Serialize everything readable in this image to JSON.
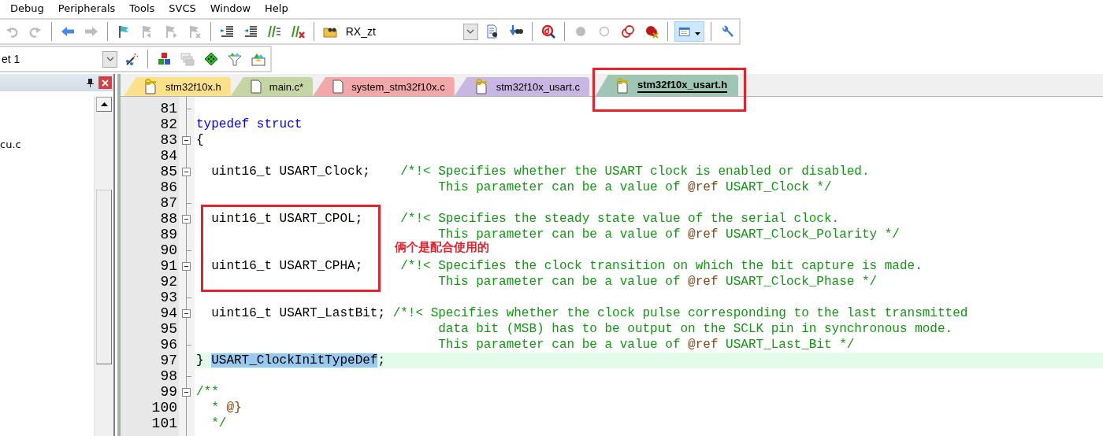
{
  "menu": [
    "Debug",
    "Peripherals",
    "Tools",
    "SVCS",
    "Window",
    "Help"
  ],
  "toolbar_1": {
    "items": [
      {
        "kind": "undo",
        "disabled": true,
        "pressed": false
      },
      {
        "kind": "redo",
        "disabled": true,
        "pressed": false
      },
      {
        "kind": "separator"
      },
      {
        "kind": "back",
        "disabled": false,
        "pressed": false
      },
      {
        "kind": "forward",
        "disabled": true,
        "pressed": false
      },
      {
        "kind": "separator"
      },
      {
        "kind": "flag",
        "disabled": false,
        "pressed": false
      },
      {
        "kind": "flagprev",
        "disabled": true,
        "pressed": false
      },
      {
        "kind": "flagnext",
        "disabled": true,
        "pressed": false
      },
      {
        "kind": "flagclear",
        "disabled": true,
        "pressed": false
      },
      {
        "kind": "separator"
      },
      {
        "kind": "indent",
        "disabled": false,
        "pressed": false
      },
      {
        "kind": "unindent",
        "disabled": false,
        "pressed": false
      },
      {
        "kind": "comment",
        "disabled": false,
        "pressed": false
      },
      {
        "kind": "uncomment",
        "disabled": false,
        "pressed": false
      },
      {
        "kind": "separator"
      },
      {
        "kind": "findfiles",
        "disabled": false,
        "pressed": false
      },
      {
        "kind": "combo",
        "value": "RX_zt"
      },
      {
        "kind": "docfind",
        "disabled": false,
        "pressed": false
      },
      {
        "kind": "binoculars",
        "disabled": false,
        "pressed": false
      },
      {
        "kind": "separator"
      },
      {
        "kind": "debug",
        "disabled": false,
        "pressed": false
      },
      {
        "kind": "separator"
      },
      {
        "kind": "dot",
        "disabled": true,
        "pressed": false
      },
      {
        "kind": "ring",
        "disabled": true,
        "pressed": false
      },
      {
        "kind": "rings",
        "disabled": false,
        "pressed": false
      },
      {
        "kind": "dotx",
        "disabled": false,
        "pressed": false
      },
      {
        "kind": "separator"
      },
      {
        "kind": "window",
        "disabled": false,
        "pressed": true
      },
      {
        "kind": "separator"
      },
      {
        "kind": "wrench",
        "disabled": false,
        "pressed": false
      }
    ]
  },
  "toolbar_2": {
    "items": [
      {
        "kind": "combo",
        "value": "et 1"
      },
      {
        "kind": "wand",
        "disabled": false,
        "pressed": false
      },
      {
        "kind": "separator"
      },
      {
        "kind": "blocks",
        "disabled": false,
        "pressed": false
      },
      {
        "kind": "stack",
        "disabled": true,
        "pressed": false
      },
      {
        "kind": "diamond",
        "disabled": false,
        "pressed": false
      },
      {
        "kind": "funnel",
        "disabled": false,
        "pressed": false
      },
      {
        "kind": "pack",
        "disabled": false,
        "pressed": false
      }
    ]
  },
  "project_panel": {
    "items": [
      "cu.c"
    ]
  },
  "editor": {
    "tabs": [
      {
        "label": "stm32f10x.h",
        "kind": "header",
        "color": "#fde18a",
        "selected": false
      },
      {
        "label": "main.c*",
        "kind": "source",
        "color": "#c5d5a4",
        "selected": false
      },
      {
        "label": "system_stm32f10x.c",
        "kind": "source",
        "color": "#f2a8a9",
        "selected": false
      },
      {
        "label": "stm32f10x_usart.c",
        "kind": "header",
        "color": "#c8b7e3",
        "selected": false
      },
      {
        "label": "stm32f10x_usart.h",
        "kind": "header",
        "color": "#9fc5b4",
        "selected": true
      }
    ],
    "lines": [
      {
        "number": "81",
        "collapsible": false,
        "block_end": true,
        "current": false
      },
      {
        "number": "82",
        "collapsible": false,
        "block_end": false,
        "current": false,
        "spans": [
          {
            "kind": "keyword",
            "text": "typedef struct"
          }
        ]
      },
      {
        "number": "83",
        "collapsible": true,
        "block_end": false,
        "current": false,
        "spans": [
          {
            "kind": "plain",
            "text": "{"
          }
        ]
      },
      {
        "number": "84",
        "collapsible": false,
        "block_end": false,
        "current": false
      },
      {
        "number": "85",
        "collapsible": true,
        "block_end": false,
        "current": false,
        "spans": [
          {
            "kind": "plain",
            "text": "  uint16_t USART_Clock;    "
          },
          {
            "kind": "comment",
            "text": "/*!< Specifies whether the USART clock is enabled or disabled."
          }
        ]
      },
      {
        "number": "86",
        "collapsible": false,
        "block_end": false,
        "current": false,
        "spans": [
          {
            "kind": "comment",
            "text": "                                This parameter can be a value of "
          },
          {
            "kind": "tag",
            "text": "@ref"
          },
          {
            "kind": "comment",
            "text": " USART_Clock */"
          }
        ]
      },
      {
        "number": "87",
        "collapsible": false,
        "block_end": true,
        "current": false
      },
      {
        "number": "88",
        "collapsible": true,
        "block_end": false,
        "current": false,
        "spans": [
          {
            "kind": "plain",
            "text": "  uint16_t USART_CPOL;     "
          },
          {
            "kind": "comment",
            "text": "/*!< Specifies the steady state value of the serial clock."
          }
        ]
      },
      {
        "number": "89",
        "collapsible": false,
        "block_end": false,
        "current": false,
        "spans": [
          {
            "kind": "comment",
            "text": "                                This parameter can be a value of "
          },
          {
            "kind": "tag",
            "text": "@ref"
          },
          {
            "kind": "comment",
            "text": " USART_Clock_Polarity */"
          }
        ]
      },
      {
        "number": "90",
        "collapsible": false,
        "block_end": true,
        "current": false
      },
      {
        "number": "91",
        "collapsible": true,
        "block_end": false,
        "current": false,
        "spans": [
          {
            "kind": "plain",
            "text": "  uint16_t USART_CPHA;     "
          },
          {
            "kind": "comment",
            "text": "/*!< Specifies the clock transition on which the bit capture is made."
          }
        ]
      },
      {
        "number": "92",
        "collapsible": false,
        "block_end": false,
        "current": false,
        "spans": [
          {
            "kind": "comment",
            "text": "                                This parameter can be a value of "
          },
          {
            "kind": "tag",
            "text": "@ref"
          },
          {
            "kind": "comment",
            "text": " USART_Clock_Phase */"
          }
        ]
      },
      {
        "number": "93",
        "collapsible": false,
        "block_end": true,
        "current": false
      },
      {
        "number": "94",
        "collapsible": true,
        "block_end": false,
        "current": false,
        "spans": [
          {
            "kind": "plain",
            "text": "  uint16_t USART_LastBit; "
          },
          {
            "kind": "comment",
            "text": "/*!< Specifies whether the clock pulse corresponding to the last transmitted"
          }
        ]
      },
      {
        "number": "95",
        "collapsible": false,
        "block_end": false,
        "current": false,
        "spans": [
          {
            "kind": "comment",
            "text": "                                data bit (MSB) has to be output on the SCLK pin in synchronous mode."
          }
        ]
      },
      {
        "number": "96",
        "collapsible": false,
        "block_end": true,
        "current": false,
        "spans": [
          {
            "kind": "comment",
            "text": "                                This parameter can be a value of "
          },
          {
            "kind": "tag",
            "text": "@ref"
          },
          {
            "kind": "comment",
            "text": " USART_Last_Bit */"
          }
        ]
      },
      {
        "number": "97",
        "collapsible": false,
        "block_end": false,
        "current": true,
        "spans": [
          {
            "kind": "plain",
            "text": "} "
          },
          {
            "kind": "selection",
            "text": "USART_ClockInitTypeDef"
          },
          {
            "kind": "plain",
            "text": ";"
          }
        ]
      },
      {
        "number": "98",
        "collapsible": false,
        "block_end": true,
        "current": false
      },
      {
        "number": "99",
        "collapsible": true,
        "block_end": false,
        "current": false,
        "spans": [
          {
            "kind": "comment",
            "text": "/**"
          }
        ]
      },
      {
        "number": "100",
        "collapsible": false,
        "block_end": false,
        "current": false,
        "spans": [
          {
            "kind": "comment",
            "text": "  * "
          },
          {
            "kind": "tag",
            "text": "@}"
          }
        ]
      },
      {
        "number": "101",
        "collapsible": false,
        "block_end": false,
        "current": false,
        "spans": [
          {
            "kind": "comment",
            "text": "  */"
          }
        ]
      }
    ]
  },
  "annotations": [
    {
      "kind": "tabframe"
    },
    {
      "kind": "lineframe"
    },
    {
      "kind": "note",
      "text": "俩个是配合使用的"
    }
  ]
}
